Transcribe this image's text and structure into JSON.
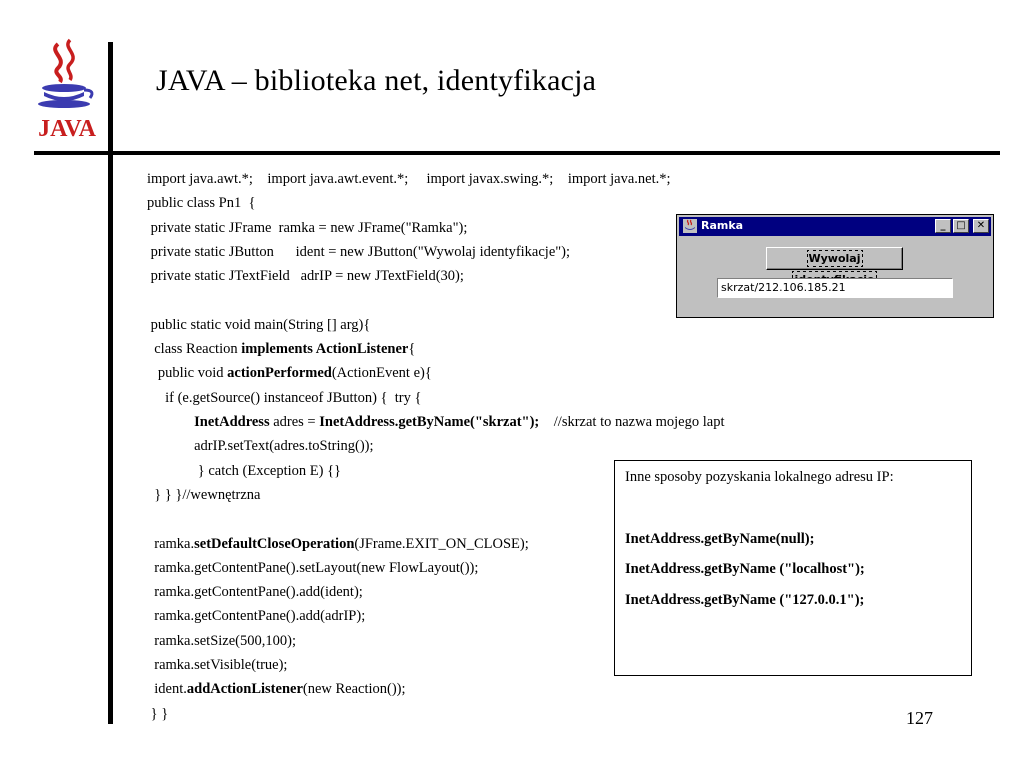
{
  "slide": {
    "title": "JAVA –  biblioteka net, identyfikacja",
    "page_number": "127",
    "logo_text": "JAVA"
  },
  "code_lines": [
    {
      "parts": [
        {
          "t": "import java.awt.*;    import java.awt.event.*;     import javax.swing.*;    import java.net.*;"
        }
      ]
    },
    {
      "parts": [
        {
          "t": "public class Pn1  {"
        }
      ]
    },
    {
      "parts": [
        {
          "t": " private static JFrame  ramka = new JFrame(\"Ramka\");"
        }
      ]
    },
    {
      "parts": [
        {
          "t": " private static JButton      ident = new JButton(\"Wywolaj identyfikacje\");"
        }
      ]
    },
    {
      "parts": [
        {
          "t": " private static JTextField   adrIP = new JTextField(30);"
        }
      ]
    },
    {
      "parts": [
        {
          "t": ""
        }
      ]
    },
    {
      "parts": [
        {
          "t": " public static void main(String [] arg){"
        }
      ]
    },
    {
      "parts": [
        {
          "t": "  class Reaction "
        },
        {
          "t": "implements ActionListener",
          "b": true
        },
        {
          "t": "{"
        }
      ]
    },
    {
      "parts": [
        {
          "t": "   public void "
        },
        {
          "t": "actionPerformed",
          "b": true
        },
        {
          "t": "(ActionEvent e){"
        }
      ]
    },
    {
      "parts": [
        {
          "t": "     if (e.getSource() instanceof JButton) {  try {"
        }
      ]
    },
    {
      "parts": [
        {
          "t": "             "
        },
        {
          "t": "InetAddress",
          "b": true
        },
        {
          "t": " adres = "
        },
        {
          "t": "InetAddress.getByName(\"skrzat\");",
          "b": true
        },
        {
          "t": "    //skrzat to nazwa mojego lapt"
        }
      ]
    },
    {
      "parts": [
        {
          "t": "             adrIP.setText(adres.toString());"
        }
      ]
    },
    {
      "parts": [
        {
          "t": "              } catch (Exception E) {}"
        }
      ]
    },
    {
      "parts": [
        {
          "t": "  } } }//wewnętrzna"
        }
      ]
    },
    {
      "parts": [
        {
          "t": ""
        }
      ]
    },
    {
      "parts": [
        {
          "t": "  ramka."
        },
        {
          "t": "setDefaultCloseOperation",
          "b": true
        },
        {
          "t": "(JFrame.EXIT_ON_CLOSE);"
        }
      ]
    },
    {
      "parts": [
        {
          "t": "  ramka.getContentPane().setLayout(new FlowLayout());"
        }
      ]
    },
    {
      "parts": [
        {
          "t": "  ramka.getContentPane().add(ident);"
        }
      ]
    },
    {
      "parts": [
        {
          "t": "  ramka.getContentPane().add(adrIP);"
        }
      ]
    },
    {
      "parts": [
        {
          "t": "  ramka.setSize(500,100);"
        }
      ]
    },
    {
      "parts": [
        {
          "t": "  ramka.setVisible(true);"
        }
      ]
    },
    {
      "parts": [
        {
          "t": "  ident."
        },
        {
          "t": "addActionListener",
          "b": true
        },
        {
          "t": "(new Reaction());"
        }
      ]
    },
    {
      "parts": [
        {
          "t": " } }"
        }
      ]
    }
  ],
  "window": {
    "title": "Ramka",
    "button_label": "Wywolaj identyfikacje",
    "field_value": "skrzat/212.106.185.21",
    "minimize_glyph": "_",
    "maximize_glyph": "□",
    "close_glyph": "✕",
    "icon": "java-cup-icon",
    "titlebar_color": "#000080",
    "face_color": "#c0c0c0"
  },
  "note": {
    "heading": "Inne sposoby pozyskania lokalnego adresu IP:",
    "lines": [
      "InetAddress.getByName(null);",
      "InetAddress.getByName (\"localhost\");",
      "InetAddress.getByName (\"127.0.0.1\");"
    ]
  }
}
